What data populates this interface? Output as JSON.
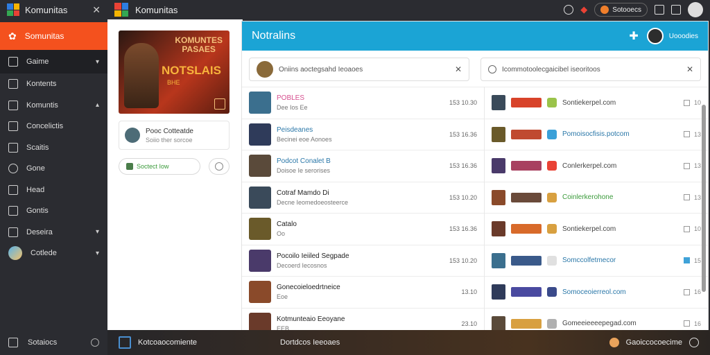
{
  "sidebar": {
    "title": "Komunitas",
    "active": "Somunitas",
    "items": [
      {
        "label": "Gaime",
        "icon": "gamepad-icon",
        "chev": "▾"
      },
      {
        "label": "Kontents",
        "icon": "document-icon",
        "chev": ""
      },
      {
        "label": "Komuntis",
        "icon": "pen-icon",
        "chev": "▴"
      },
      {
        "label": "Concelictis",
        "icon": "folder-icon",
        "chev": ""
      },
      {
        "label": "Scaitis",
        "icon": "toolbox-icon",
        "chev": ""
      },
      {
        "label": "Gone",
        "icon": "circle-icon",
        "chev": ""
      },
      {
        "label": "Head",
        "icon": "bag-icon",
        "chev": ""
      },
      {
        "label": "Gontis",
        "icon": "lock-icon",
        "chev": ""
      },
      {
        "label": "Deseira",
        "icon": "home-icon",
        "chev": "▾"
      },
      {
        "label": "Cotlede",
        "icon": "avatar-icon",
        "chev": "▾"
      }
    ],
    "footer": "Sotaiocs"
  },
  "topbar": {
    "title": "Komunitas",
    "pill_label": "Sotooecs"
  },
  "leftcol": {
    "hero_title": "KOMUNTES\nPASAES",
    "hero_big": "NOTSLAIS",
    "hero_small": "BHE",
    "profile_name": "Pooc Cotteatde",
    "profile_sub": "Soiio ther sorcoe",
    "action_label": "Soctect Iow"
  },
  "main": {
    "header_title": "Notralins",
    "user_name": "Uooodies",
    "search_left": "Oniins aoctegsahd Ieoaoes",
    "search_right": "Icommotoolecgaicibel iseoritoos",
    "rows_left": [
      {
        "title": "POBLES",
        "sub": "Dee Ios Ee",
        "time": "153 10.30",
        "style": "pink"
      },
      {
        "title": "Peisdeanes",
        "sub": "Becinei eoe Aonoes",
        "time": "153 16.36",
        "style": ""
      },
      {
        "title": "Podcot Conalet  B",
        "sub": "Doisoe Ie serorises",
        "time": "153 16.36",
        "style": ""
      },
      {
        "title": "Cotraf Mamdo Di",
        "sub": "Decne Ieomedoeosteerce",
        "time": "153 10.20",
        "style": "dark"
      },
      {
        "title": "Catalo",
        "sub": "Oo",
        "time": "153 16.36",
        "style": "dark"
      },
      {
        "title": "Pocoilo Ieiiled Segpade",
        "sub": "Decoerd Iecosnos",
        "time": "153 10.20",
        "style": "dark"
      },
      {
        "title": "Gonecoieloedrtneice",
        "sub": "Eoe",
        "time": "13.10",
        "style": "dark"
      },
      {
        "title": "Kotmunteaio Eeoyane",
        "sub": "EEB",
        "time": "23.10",
        "style": "dark"
      }
    ],
    "rows_right": [
      {
        "site": "Sontiekerpel.com",
        "meta": "10",
        "style": "",
        "checked": false
      },
      {
        "site": "Pomoisocfisis.potcom",
        "meta": "13",
        "style": "blue",
        "checked": false
      },
      {
        "site": "Conlerkerpel.com",
        "meta": "13",
        "style": "",
        "checked": false
      },
      {
        "site": "Coinlerkerohone",
        "meta": "13",
        "style": "green",
        "checked": false
      },
      {
        "site": "Sontiekerpel.com",
        "meta": "10",
        "style": "",
        "checked": false
      },
      {
        "site": "Somccolfetmecor",
        "meta": "15",
        "style": "blue",
        "checked": true
      },
      {
        "site": "Somoceoierreol.com",
        "meta": "16",
        "style": "blue",
        "checked": false
      },
      {
        "site": "Gomeeieeeepegad.com",
        "meta": "16",
        "style": "",
        "checked": false
      }
    ]
  },
  "bottombar": {
    "left_label": "Kotcoaocomiente",
    "left_label2": "Dortdcos Ieeoaes",
    "right_label": "Gaoiccocoecime"
  },
  "colors": {
    "accent_orange": "#f4511e",
    "header_blue": "#1ba4d5",
    "sidebar_bg": "#2b2c31"
  }
}
